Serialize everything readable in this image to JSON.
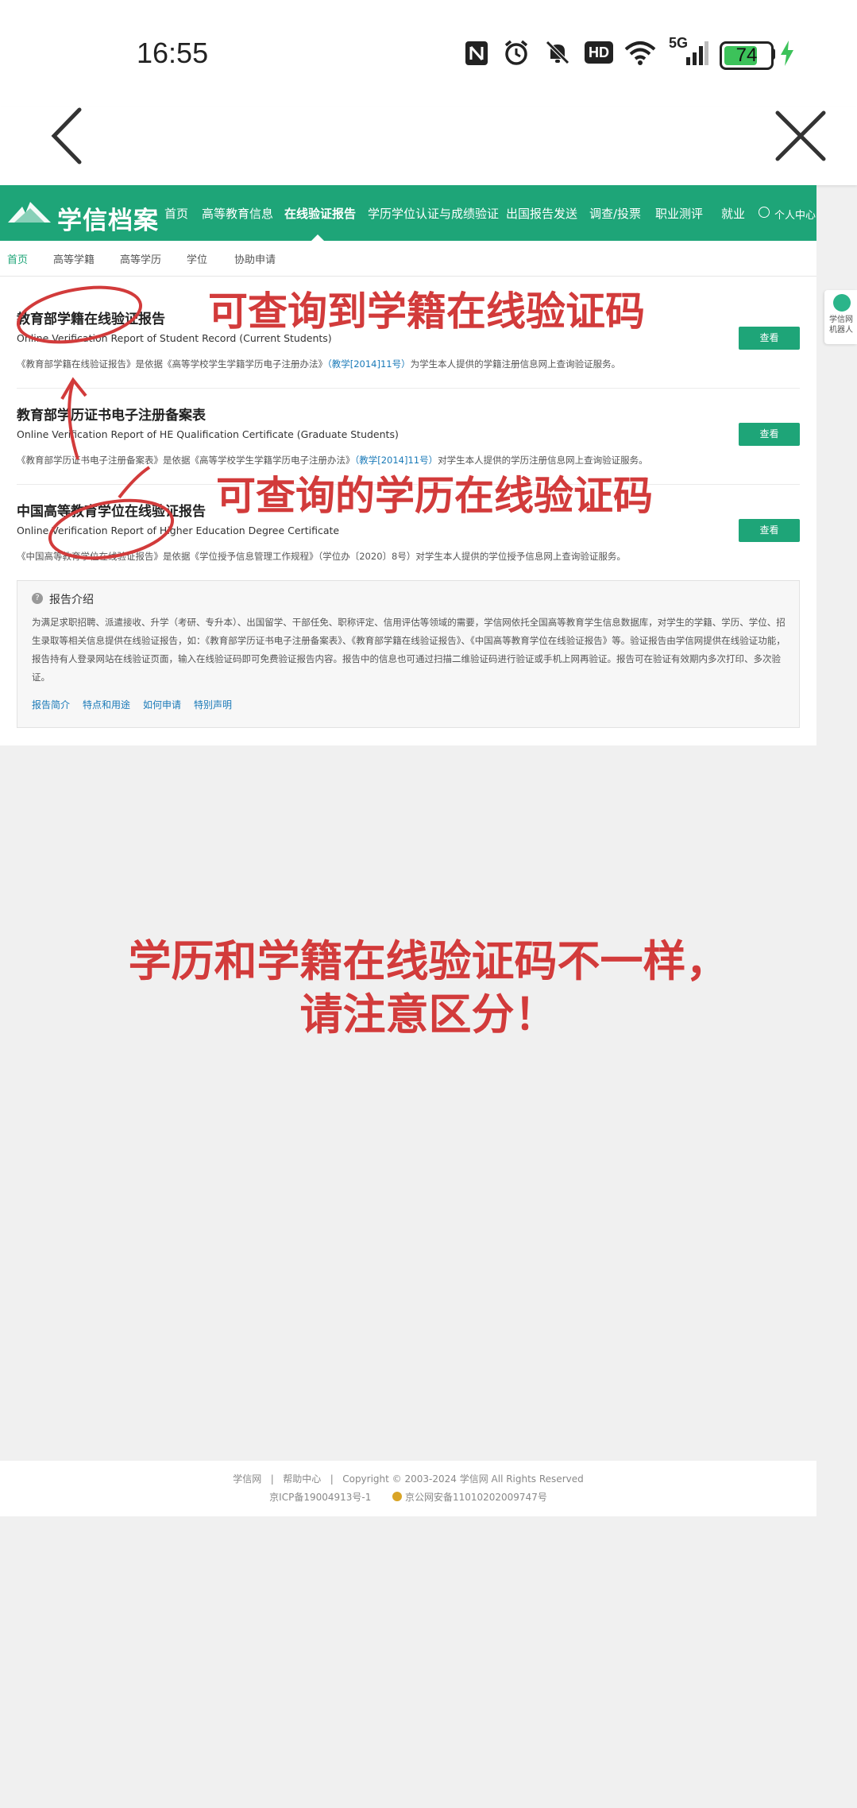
{
  "status_bar": {
    "time": "16:55",
    "icons": [
      "nfc-icon",
      "alarm-icon",
      "mute-icon",
      "hd-icon",
      "wifi-icon",
      "5g-signal-icon"
    ],
    "battery": 74,
    "battery_label": "74",
    "network": "5G",
    "hd_label": "HD"
  },
  "nav": {
    "back_icon": "chevron-left-icon",
    "close_icon": "close-icon"
  },
  "site": {
    "logo": "学信档案",
    "nav_items": [
      "首页",
      "高等教育信息",
      "在线验证报告",
      "学历学位认证与成绩验证",
      "出国报告发送",
      "调查/投票",
      "职业测评",
      "就业"
    ],
    "active_nav": "在线验证报告",
    "user_center": "个人中心",
    "sub_nav": [
      "首页",
      "高等学籍",
      "高等学历",
      "学位",
      "协助申请"
    ],
    "active_sub": "首页"
  },
  "reports": [
    {
      "title": "教育部学籍在线验证报告",
      "en": "Online Verification Report of Student Record (Current Students)",
      "desc_pre": "《教育部学籍在线验证报告》是依据《高等学校学生学籍学历电子注册办法》",
      "desc_ref": "（教学[2014]11号）",
      "desc_post": "为学生本人提供的学籍注册信息网上查询验证服务。",
      "button": "查看"
    },
    {
      "title": "教育部学历证书电子注册备案表",
      "en": "Online Verification Report of HE Qualification Certificate (Graduate Students)",
      "desc_pre": "《教育部学历证书电子注册备案表》是依据《高等学校学生学籍学历电子注册办法》",
      "desc_ref": "（教学[2014]11号）",
      "desc_post": "对学生本人提供的学历注册信息网上查询验证服务。",
      "button": "查看"
    },
    {
      "title": "中国高等教育学位在线验证报告",
      "en": "Online Verification Report of Higher Education Degree Certificate",
      "desc_pre": "《中国高等教育学位在线验证报告》是依据《学位授予信息管理工作规程》（学位办〔2020〕8号）对学生本人提供的学位授予信息网上查询验证服务。",
      "desc_ref": "",
      "desc_post": "",
      "button": "查看"
    }
  ],
  "intro": {
    "title": "报告介绍",
    "body": "为满足求职招聘、派遣接收、升学（考研、专升本）、出国留学、干部任免、职称评定、信用评估等领域的需要，学信网依托全国高等教育学生信息数据库，对学生的学籍、学历、学位、招生录取等相关信息提供在线验证报告，如：《教育部学历证书电子注册备案表》、《教育部学籍在线验证报告》、《中国高等教育学位在线验证报告》等。验证报告由学信网提供在线验证功能，报告持有人登录网站在线验证页面，输入在线验证码即可免费验证报告内容。报告中的信息也可通过扫描二维验证码进行验证或手机上网再验证。报告可在验证有效期内多次打印、多次验证。",
    "links": [
      "报告简介",
      "特点和用途",
      "如何申请",
      "特别声明"
    ]
  },
  "robot": {
    "label": "学信网机器人"
  },
  "annotations": {
    "a1": "可查询到学籍在线验证码",
    "a2": "可查询的学历在线验证码",
    "a3_line1": "学历和学籍在线验证码不一样，",
    "a3_line2": "请注意区分！",
    "color": "#d23b3b"
  },
  "footer": {
    "links": [
      "学信网",
      "帮助中心"
    ],
    "copyright": "Copyright © 2003-2024 学信网 All Rights Reserved",
    "icp": "京ICP备19004913号-1",
    "police": "京公网安备11010202009747号"
  },
  "colors": {
    "brand": "#1ea578",
    "link": "#1a7ab8"
  }
}
